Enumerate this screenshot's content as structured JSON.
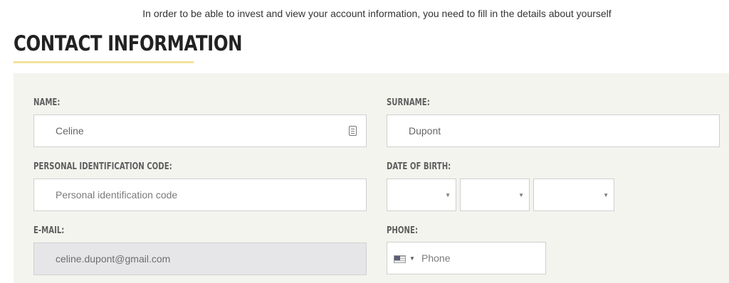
{
  "intro_text": "In order to be able to invest and view your account information, you need to fill in the details about yourself",
  "section": {
    "title": "CONTACT INFORMATION",
    "underline_color": "#f0e39b"
  },
  "fields": {
    "name": {
      "label": "NAME:",
      "value": "Celine",
      "icon": "autofill-contact-icon"
    },
    "surname": {
      "label": "SURNAME:",
      "value": "Dupont"
    },
    "personal_code": {
      "label": "PERSONAL IDENTIFICATION CODE:",
      "placeholder": "Personal identification code"
    },
    "date_of_birth": {
      "label": "DATE OF BIRTH:",
      "day": "",
      "month": "",
      "year": ""
    },
    "email": {
      "label": "E-MAIL:",
      "value": "celine.dupont@gmail.com",
      "disabled": true
    },
    "phone": {
      "label": "PHONE:",
      "placeholder": "Phone",
      "country_icon": "us-flag-icon"
    }
  },
  "colors": {
    "panel_background": "#f4f4ef",
    "disabled_field": "#e6e6e9"
  }
}
